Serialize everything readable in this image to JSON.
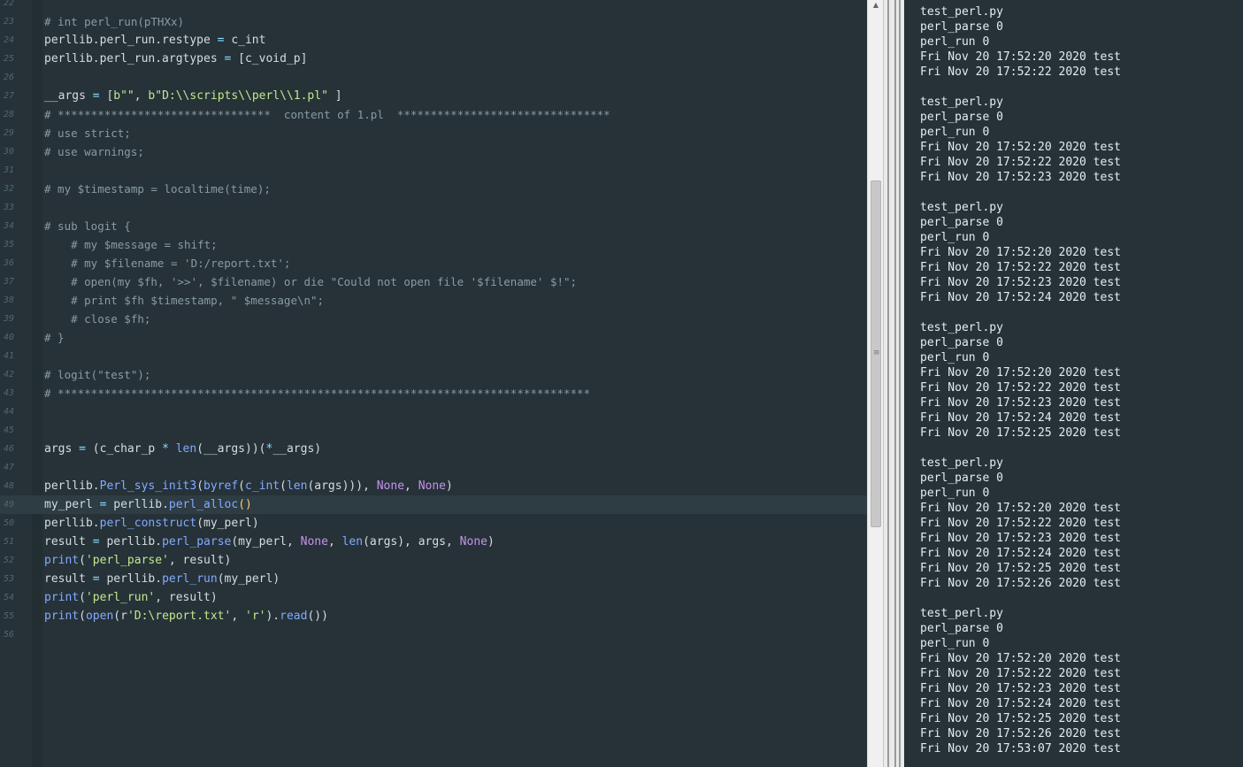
{
  "editor": {
    "lines": [
      {
        "n": "22",
        "t": []
      },
      {
        "n": "23",
        "t": [
          [
            "cm",
            "# int perl_run(pTHXx)"
          ]
        ]
      },
      {
        "n": "24",
        "t": [
          [
            "",
            "perllib.perl_run.restype "
          ],
          [
            "op",
            "="
          ],
          [
            "",
            " c_int"
          ]
        ]
      },
      {
        "n": "25",
        "t": [
          [
            "",
            "perllib.perl_run.argtypes "
          ],
          [
            "op",
            "="
          ],
          [
            "",
            " [c_void_p]"
          ]
        ]
      },
      {
        "n": "26",
        "t": []
      },
      {
        "n": "27",
        "t": [
          [
            "",
            "__args "
          ],
          [
            "op",
            "="
          ],
          [
            "",
            " ["
          ],
          [
            "st",
            "b\"\""
          ],
          [
            "",
            ", "
          ],
          [
            "st",
            "b\"D:\\\\scripts\\\\perl\\\\1.pl\""
          ],
          [
            "",
            " ]"
          ]
        ]
      },
      {
        "n": "28",
        "t": [
          [
            "cm",
            "# ********************************  content of 1.pl  ********************************"
          ]
        ]
      },
      {
        "n": "29",
        "t": [
          [
            "cm",
            "# use strict;"
          ]
        ]
      },
      {
        "n": "30",
        "t": [
          [
            "cm",
            "# use warnings;"
          ]
        ]
      },
      {
        "n": "31",
        "t": []
      },
      {
        "n": "32",
        "t": [
          [
            "cm",
            "# my $timestamp = localtime(time);"
          ]
        ]
      },
      {
        "n": "33",
        "t": []
      },
      {
        "n": "34",
        "t": [
          [
            "cm",
            "# sub logit {"
          ]
        ]
      },
      {
        "n": "35",
        "t": [
          [
            "cm",
            "    # my $message = shift;"
          ]
        ]
      },
      {
        "n": "36",
        "t": [
          [
            "cm",
            "    # my $filename = 'D:/report.txt';"
          ]
        ]
      },
      {
        "n": "37",
        "t": [
          [
            "cm",
            "    # open(my $fh, '>>', $filename) or die \"Could not open file '$filename' $!\";"
          ]
        ]
      },
      {
        "n": "38",
        "t": [
          [
            "cm",
            "    # print $fh $timestamp, \" $message\\n\";"
          ]
        ]
      },
      {
        "n": "39",
        "t": [
          [
            "cm",
            "    # close $fh;"
          ]
        ]
      },
      {
        "n": "40",
        "t": [
          [
            "cm",
            "# }"
          ]
        ]
      },
      {
        "n": "41",
        "t": []
      },
      {
        "n": "42",
        "t": [
          [
            "cm",
            "# logit(\"test\");"
          ]
        ]
      },
      {
        "n": "43",
        "t": [
          [
            "cm",
            "# ********************************************************************************"
          ]
        ]
      },
      {
        "n": "44",
        "t": []
      },
      {
        "n": "45",
        "t": []
      },
      {
        "n": "46",
        "t": [
          [
            "",
            "args "
          ],
          [
            "op",
            "="
          ],
          [
            "",
            " (c_char_p "
          ],
          [
            "op",
            "*"
          ],
          [
            "",
            " "
          ],
          [
            "fn",
            "len"
          ],
          [
            "",
            "(__args))("
          ],
          [
            "op",
            "*"
          ],
          [
            "",
            "__args)"
          ]
        ]
      },
      {
        "n": "47",
        "t": []
      },
      {
        "n": "48",
        "t": [
          [
            "",
            "perllib."
          ],
          [
            "fn",
            "Perl_sys_init3"
          ],
          [
            "",
            "("
          ],
          [
            "fn",
            "byref"
          ],
          [
            "",
            "("
          ],
          [
            "fn",
            "c_int"
          ],
          [
            "",
            "("
          ],
          [
            "fn",
            "len"
          ],
          [
            "",
            "(args))), "
          ],
          [
            "kw",
            "None"
          ],
          [
            "",
            ", "
          ],
          [
            "kw",
            "None"
          ],
          [
            "",
            ")"
          ]
        ]
      },
      {
        "n": "49",
        "active": true,
        "t": [
          [
            "",
            "my_perl "
          ],
          [
            "op",
            "="
          ],
          [
            "",
            " perllib."
          ],
          [
            "fn",
            "perl_alloc"
          ],
          [
            "pr",
            "()"
          ]
        ]
      },
      {
        "n": "50",
        "t": [
          [
            "",
            "perllib."
          ],
          [
            "fn",
            "perl_construct"
          ],
          [
            "",
            "(my_perl)"
          ]
        ]
      },
      {
        "n": "51",
        "t": [
          [
            "",
            "result "
          ],
          [
            "op",
            "="
          ],
          [
            "",
            " perllib."
          ],
          [
            "fn",
            "perl_parse"
          ],
          [
            "",
            "(my_perl, "
          ],
          [
            "kw",
            "None"
          ],
          [
            "",
            ", "
          ],
          [
            "fn",
            "len"
          ],
          [
            "",
            "(args), args, "
          ],
          [
            "kw",
            "None"
          ],
          [
            "",
            ")"
          ]
        ]
      },
      {
        "n": "52",
        "t": [
          [
            "fn",
            "print"
          ],
          [
            "",
            "("
          ],
          [
            "st",
            "'perl_parse'"
          ],
          [
            "",
            ", result)"
          ]
        ]
      },
      {
        "n": "53",
        "t": [
          [
            "",
            "result "
          ],
          [
            "op",
            "="
          ],
          [
            "",
            " perllib."
          ],
          [
            "fn",
            "perl_run"
          ],
          [
            "",
            "(my_perl)"
          ]
        ]
      },
      {
        "n": "54",
        "t": [
          [
            "fn",
            "print"
          ],
          [
            "",
            "("
          ],
          [
            "st",
            "'perl_run'"
          ],
          [
            "",
            ", result)"
          ]
        ]
      },
      {
        "n": "55",
        "t": [
          [
            "fn",
            "print"
          ],
          [
            "",
            "("
          ],
          [
            "fn",
            "open"
          ],
          [
            "",
            "(r"
          ],
          [
            "st",
            "'D:\\report.txt'"
          ],
          [
            "",
            ", "
          ],
          [
            "st",
            "'r'"
          ],
          [
            "",
            ")."
          ],
          [
            "fn",
            "read"
          ],
          [
            "",
            "())"
          ]
        ]
      },
      {
        "n": "56",
        "t": []
      }
    ]
  },
  "scrollbar": {
    "up_arrow": "▲",
    "grip": "≡"
  },
  "output": {
    "lines": [
      "test_perl.py",
      "perl_parse 0",
      "perl_run 0",
      "Fri Nov 20 17:52:20 2020 test",
      "Fri Nov 20 17:52:22 2020 test",
      "",
      "test_perl.py",
      "perl_parse 0",
      "perl_run 0",
      "Fri Nov 20 17:52:20 2020 test",
      "Fri Nov 20 17:52:22 2020 test",
      "Fri Nov 20 17:52:23 2020 test",
      "",
      "test_perl.py",
      "perl_parse 0",
      "perl_run 0",
      "Fri Nov 20 17:52:20 2020 test",
      "Fri Nov 20 17:52:22 2020 test",
      "Fri Nov 20 17:52:23 2020 test",
      "Fri Nov 20 17:52:24 2020 test",
      "",
      "test_perl.py",
      "perl_parse 0",
      "perl_run 0",
      "Fri Nov 20 17:52:20 2020 test",
      "Fri Nov 20 17:52:22 2020 test",
      "Fri Nov 20 17:52:23 2020 test",
      "Fri Nov 20 17:52:24 2020 test",
      "Fri Nov 20 17:52:25 2020 test",
      "",
      "test_perl.py",
      "perl_parse 0",
      "perl_run 0",
      "Fri Nov 20 17:52:20 2020 test",
      "Fri Nov 20 17:52:22 2020 test",
      "Fri Nov 20 17:52:23 2020 test",
      "Fri Nov 20 17:52:24 2020 test",
      "Fri Nov 20 17:52:25 2020 test",
      "Fri Nov 20 17:52:26 2020 test",
      "",
      "test_perl.py",
      "perl_parse 0",
      "perl_run 0",
      "Fri Nov 20 17:52:20 2020 test",
      "Fri Nov 20 17:52:22 2020 test",
      "Fri Nov 20 17:52:23 2020 test",
      "Fri Nov 20 17:52:24 2020 test",
      "Fri Nov 20 17:52:25 2020 test",
      "Fri Nov 20 17:52:26 2020 test",
      "Fri Nov 20 17:53:07 2020 test"
    ]
  },
  "colors": {
    "editor_bg": "#263238",
    "comment": "#8a9ba3",
    "string": "#c3e88d",
    "function": "#82aaff",
    "keyword": "#c792ea",
    "operator": "#89ddff",
    "paren_match": "#ffcb6b"
  }
}
